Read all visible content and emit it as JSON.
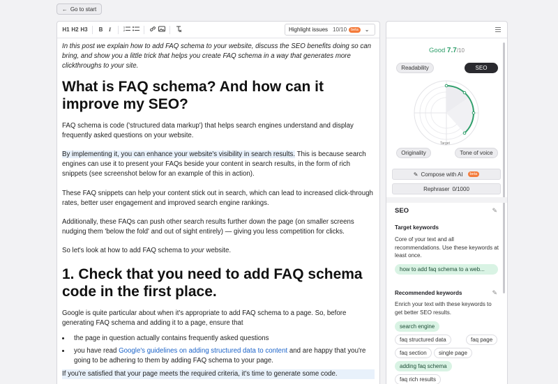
{
  "top": {
    "go_start": "Go to start"
  },
  "toolbar": {
    "h1": "H1",
    "h2": "H2",
    "h3": "H3",
    "bold": "B",
    "italic": "I",
    "highlight_label": "Highlight issues",
    "highlight_count": "10/10",
    "beta": "beta"
  },
  "article": {
    "intro": "In this post we explain how to add FAQ schema to your website, discuss the SEO benefits doing so can bring, and show you a little trick that helps you create FAQ schema in a way that generates more clickthroughs to your site.",
    "h1": "What is FAQ schema? And how can it improve my SEO?",
    "p1": "FAQ schema is code ('structured data markup') that helps search engines understand and display frequently asked questions on your website.",
    "p2_highlight": "By implementing it, you can enhance your website's visibility in search results.",
    "p2_rest": " This is because search engines can use it to present your FAQs beside your content in search results, in the form of rich snippets (see screenshot below for an example of this in action).",
    "p3": "These FAQ snippets can help your content stick out in search, which can lead to increased click-through rates, better user engagement and improved search engine rankings.",
    "p4": "Additionally, these FAQs can push other search results further down the page (on smaller screens nudging them 'below the fold' and out of sight entirely) — giving you less competition for clicks.",
    "p5_a": "So let's look at how to add FAQ schema to ",
    "p5_your": "your",
    "p5_b": " website.",
    "h2": "1. Check that you need to add FAQ schema code in the first place.",
    "p6": "Google is quite particular about when it's appropriate to add FAQ schema to a page. So, before generating FAQ schema and adding it to a page, ensure that",
    "li1": "the page in question actually contains frequently asked questions",
    "li2_a": "you have read ",
    "li2_link": "Google's guidelines on adding structured data to content",
    "li2_b": " and are happy that you're going to be adhering to them by adding FAQ schema to your page.",
    "p7": "If you're satisfied that your page meets the required criteria, it's time to generate some code."
  },
  "panel": {
    "score_label": "Good",
    "score_value": "7.7",
    "score_max": "/10",
    "tabs": {
      "readability": "Readability",
      "seo": "SEO",
      "originality": "Originality",
      "tone": "Tone of voice"
    },
    "target_label": "Target",
    "compose": "Compose with AI",
    "compose_badge": "beta",
    "rephraser": "Rephraser",
    "rephraser_count": "0/1000",
    "seo_title": "SEO",
    "target_kw_title": "Target keywords",
    "target_kw_desc": "Core of your text and all recommendations. Use these keywords at least once.",
    "target_kw": "how to add faq schema to a web...",
    "rec_kw_title": "Recommended keywords",
    "rec_kw_desc": "Enrich your text with these keywords to get better SEO results.",
    "rec_kws": [
      "search engine",
      "faq structured data",
      "faq page",
      "faq section",
      "single page",
      "adding faq schema",
      "faq rich results"
    ]
  },
  "colors": {
    "good": "#2e9e6a",
    "accent_badge": "#f47b3b",
    "keyword_green": "#d9f3e4",
    "link": "#1b63c9"
  }
}
